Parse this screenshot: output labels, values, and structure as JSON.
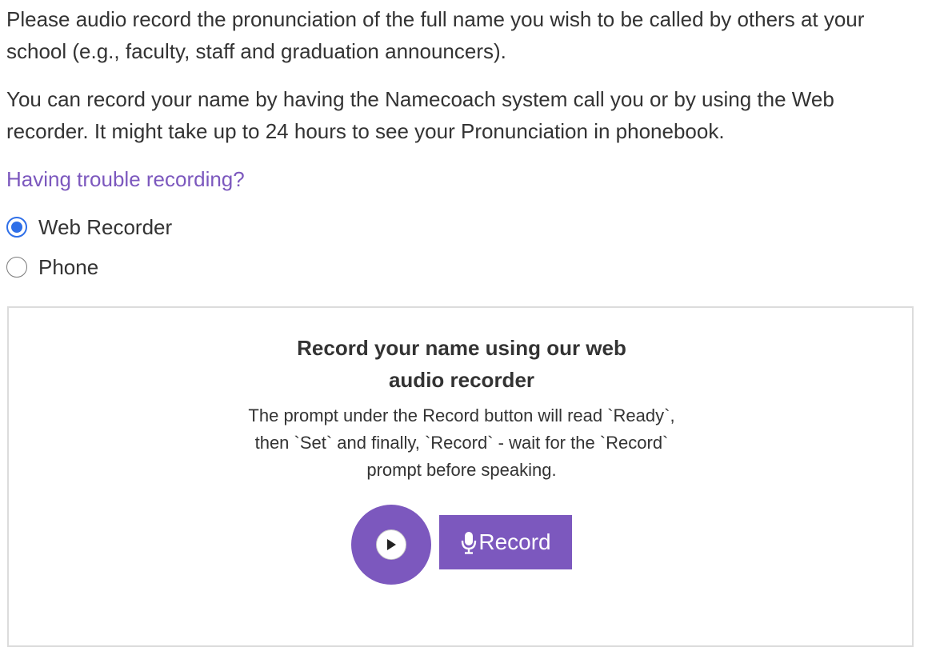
{
  "intro": {
    "paragraph1": "Please audio record the pronunciation of the full name you wish to be called by others at your school (e.g., faculty, staff and graduation announcers).",
    "paragraph2": "You can record your name by having the Namecoach system call you or by using the Web recorder. It might take up to 24 hours to see your Pronunciation in phonebook."
  },
  "help_link": "Having trouble recording?",
  "recording_method": {
    "selected": "Web Recorder",
    "options": [
      {
        "label": "Web Recorder",
        "checked": true
      },
      {
        "label": "Phone",
        "checked": false
      }
    ]
  },
  "recorder": {
    "title": "Record your name using our web audio recorder",
    "instructions": "The prompt under the Record button will read `Ready`, then `Set` and finally, `Record` - wait for the `Record` prompt before speaking.",
    "record_button_label": "Record",
    "record_icon": "microphone-icon",
    "play_icon": "play-icon"
  },
  "colors": {
    "accent_purple": "#7c58be",
    "radio_blue": "#2f6fe8",
    "text": "#333333",
    "border": "#dcdcdc"
  }
}
